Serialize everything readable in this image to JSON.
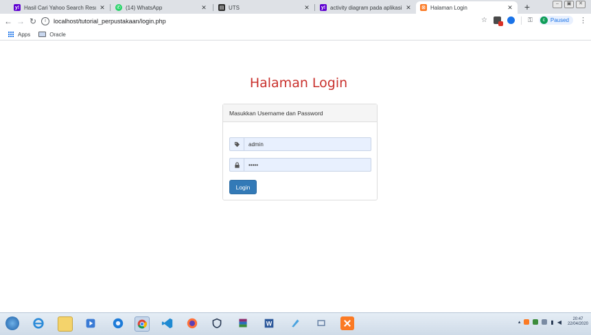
{
  "browser": {
    "tabs": [
      {
        "title": "Hasil Cari Yahoo Search Results",
        "icon": "yahoo-icon",
        "color": "#5f01d1",
        "glyph": "y!",
        "active": false
      },
      {
        "title": "(14) WhatsApp",
        "icon": "whatsapp-icon",
        "color": "#25d366",
        "glyph": "✆",
        "active": false
      },
      {
        "title": "UTS",
        "icon": "classroom-icon",
        "color": "#2b2b2b",
        "glyph": "▤",
        "active": false
      },
      {
        "title": "activity diagram pada aplikasi k",
        "icon": "yahoo-icon",
        "color": "#5f01d1",
        "glyph": "y!",
        "active": false
      },
      {
        "title": "Halaman Login",
        "icon": "xampp-icon",
        "color": "#fb7a24",
        "glyph": "⊠",
        "active": true
      }
    ],
    "new_tab_label": "+",
    "address": "localhost/tutorial_perpustakaan/login.php",
    "profile_initial": "c",
    "profile_status": "Paused",
    "bookmarks": [
      {
        "label": "Apps",
        "icon": "apps-grid-icon"
      },
      {
        "label": "Oracle",
        "icon": "folder-icon"
      }
    ]
  },
  "page": {
    "heading": "Halaman Login",
    "panel_title": "Masukkan Username dan Password",
    "username_value": "admin",
    "password_value": "•••••",
    "login_label": "Login"
  },
  "taskbar": {
    "clock_time": "20:47",
    "clock_date": "22/04/2020",
    "colors": {
      "accent": "#337ab7",
      "heading": "#c9302c"
    }
  }
}
